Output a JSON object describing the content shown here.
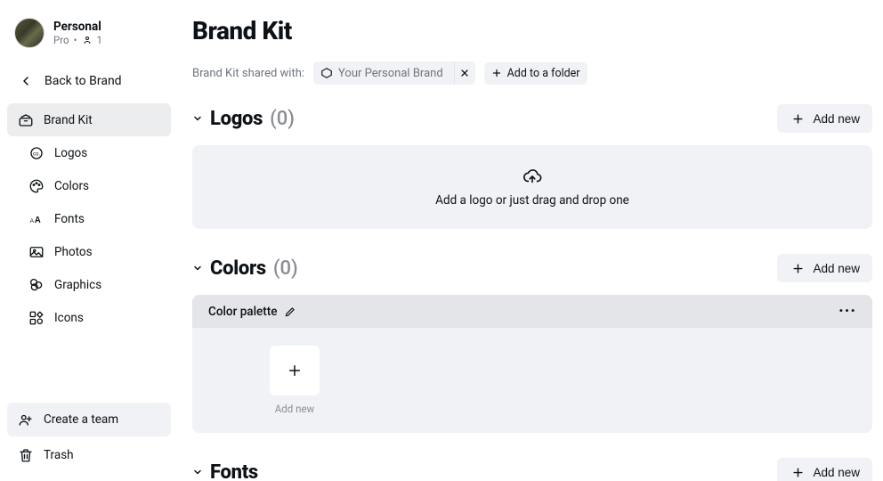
{
  "profile": {
    "name": "Personal",
    "plan": "Pro",
    "members": "1"
  },
  "sidebar": {
    "back_label": "Back to Brand",
    "items": [
      {
        "label": "Brand Kit"
      },
      {
        "label": "Logos"
      },
      {
        "label": "Colors"
      },
      {
        "label": "Fonts"
      },
      {
        "label": "Photos"
      },
      {
        "label": "Graphics"
      },
      {
        "label": "Icons"
      }
    ],
    "create_team": "Create a team",
    "trash": "Trash"
  },
  "page": {
    "title": "Brand Kit",
    "shared_with_label": "Brand Kit shared with:",
    "shared_chip": "Your Personal Brand",
    "add_folder": "Add to a folder"
  },
  "sections": {
    "logos": {
      "title": "Logos",
      "count": "(0)",
      "add_new": "Add new",
      "dropzone_text": "Add a logo or just drag and drop one"
    },
    "colors": {
      "title": "Colors",
      "count": "(0)",
      "add_new": "Add new",
      "palette_title": "Color palette",
      "tile_label": "Add new"
    },
    "fonts": {
      "title": "Fonts",
      "add_new": "Add new"
    }
  }
}
